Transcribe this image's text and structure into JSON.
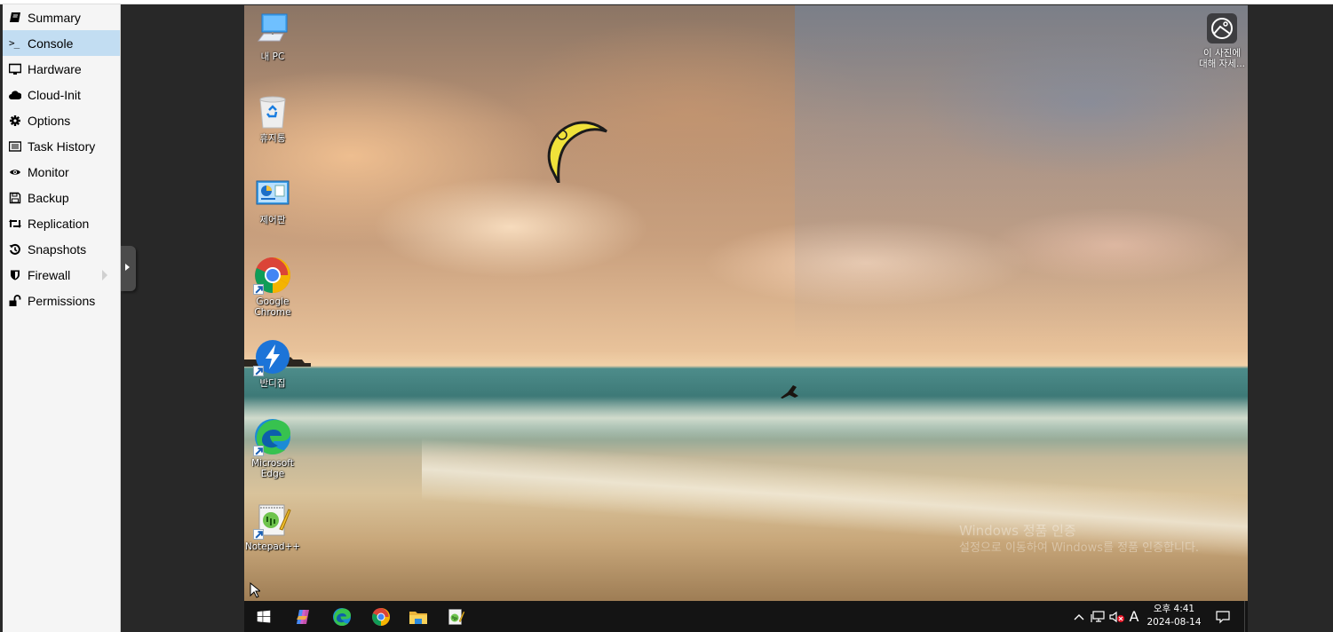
{
  "sidebar": {
    "items": [
      {
        "label": "Summary",
        "icon": "book-icon",
        "selected": false
      },
      {
        "label": "Console",
        "icon": "terminal-icon",
        "selected": true
      },
      {
        "label": "Hardware",
        "icon": "monitor-icon",
        "selected": false
      },
      {
        "label": "Cloud-Init",
        "icon": "cloud-icon",
        "selected": false
      },
      {
        "label": "Options",
        "icon": "gear-icon",
        "selected": false
      },
      {
        "label": "Task History",
        "icon": "list-icon",
        "selected": false
      },
      {
        "label": "Monitor",
        "icon": "eye-icon",
        "selected": false
      },
      {
        "label": "Backup",
        "icon": "floppy-icon",
        "selected": false
      },
      {
        "label": "Replication",
        "icon": "retweet-icon",
        "selected": false
      },
      {
        "label": "Snapshots",
        "icon": "history-icon",
        "selected": false
      },
      {
        "label": "Firewall",
        "icon": "shield-icon",
        "selected": false,
        "has_submenu": true
      },
      {
        "label": "Permissions",
        "icon": "unlock-icon",
        "selected": false
      }
    ],
    "selected_color": "#c2ddf2"
  },
  "console": {
    "desktop_icons": [
      {
        "label": "내 PC",
        "icon": "this-pc-icon",
        "shortcut": false
      },
      {
        "label": "휴지통",
        "icon": "recycle-bin-icon",
        "shortcut": false
      },
      {
        "label": "제어판",
        "icon": "control-panel-icon",
        "shortcut": false
      },
      {
        "label": "Google Chrome",
        "icon": "chrome-icon",
        "shortcut": true
      },
      {
        "label": "반디집",
        "icon": "bandizip-icon",
        "shortcut": true
      },
      {
        "label": "Microsoft Edge",
        "icon": "edge-icon",
        "shortcut": true
      },
      {
        "label": "Notepad++",
        "icon": "notepadpp-icon",
        "shortcut": true
      }
    ],
    "photo_info": {
      "label_line1": "이 사진에",
      "label_line2": "대해 자세..."
    },
    "watermark": {
      "line1": "Windows 정품 인증",
      "line2": "설정으로 이동하여 Windows를 정품 인증합니다."
    },
    "taskbar": {
      "pinned": [
        {
          "name": "start",
          "icon": "windows-logo-icon"
        },
        {
          "name": "copilot",
          "icon": "copilot-icon"
        },
        {
          "name": "edge",
          "icon": "edge-icon"
        },
        {
          "name": "chrome",
          "icon": "chrome-icon"
        },
        {
          "name": "file-explorer",
          "icon": "folder-icon"
        },
        {
          "name": "notepad++",
          "icon": "notepadpp-icon"
        }
      ],
      "tray": {
        "ime": "A",
        "time": "오후 4:41",
        "date": "2024-08-14"
      }
    }
  }
}
